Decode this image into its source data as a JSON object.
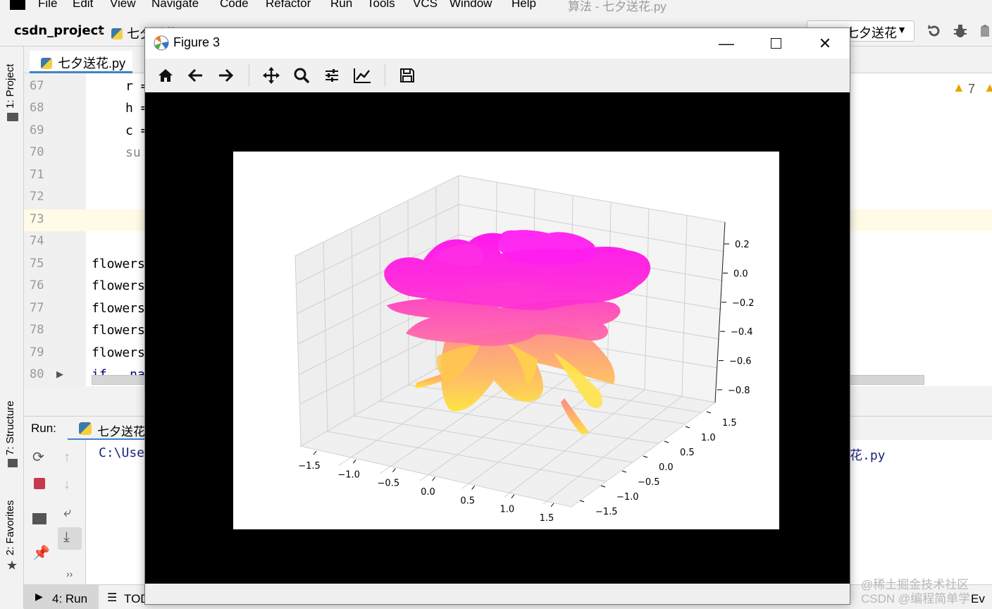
{
  "ide": {
    "menu": [
      "File",
      "Edit",
      "View",
      "Navigate",
      "Code",
      "Refactor",
      "Run",
      "Tools",
      "VCS",
      "Window",
      "Help"
    ],
    "window_title": "算法 - 七夕送花.py",
    "project": "csdn_project",
    "breadcrumb_file": "七夕送花",
    "run_config": "七夕送花",
    "editor_tab": "七夕送花.py",
    "warning_count": "7",
    "left_tabs": {
      "project": "1: Project",
      "structure": "7: Structure",
      "favorites": "2: Favorites"
    },
    "lines": [
      {
        "n": "67",
        "code": "r ="
      },
      {
        "n": "68",
        "code": "h ="
      },
      {
        "n": "69",
        "code": "c ="
      },
      {
        "n": "70",
        "code": "su"
      },
      {
        "n": "71",
        "code": ""
      },
      {
        "n": "72",
        "code": ""
      },
      {
        "n": "73",
        "code": ""
      },
      {
        "n": "74",
        "code": ""
      },
      {
        "n": "75",
        "code": "flowers"
      },
      {
        "n": "76",
        "code": "flowers"
      },
      {
        "n": "77",
        "code": "flowers"
      },
      {
        "n": "78",
        "code": "flowers"
      },
      {
        "n": "79",
        "code": "flowers"
      },
      {
        "n": "80",
        "code": "if __na"
      }
    ],
    "run_label": "Run:",
    "run_tab": "七夕送花",
    "console_left": "C:\\Use",
    "console_right": "花.py",
    "bottom_tabs": [
      "4: Run",
      "TODO"
    ],
    "bottom_right": "Ev"
  },
  "figure": {
    "title": "Figure 3",
    "toolbar": [
      "home-icon",
      "back-icon",
      "forward-icon",
      "pan-icon",
      "zoom-icon",
      "configure-icon",
      "edit-axes-icon",
      "save-icon"
    ]
  },
  "chart_data": {
    "type": "surface3d",
    "title": "",
    "x_ticks": [
      "−1.5",
      "−1.0",
      "−0.5",
      "0.0",
      "0.5",
      "1.0",
      "1.5"
    ],
    "y_ticks": [
      "−1.5",
      "−1.0",
      "−0.5",
      "0.0",
      "0.5",
      "1.0",
      "1.5"
    ],
    "z_ticks": [
      "0.2",
      "0.0",
      "−0.2",
      "−0.4",
      "−0.6",
      "−0.8"
    ],
    "xlim": [
      -1.5,
      1.5
    ],
    "ylim": [
      -1.5,
      1.5
    ],
    "zlim": [
      -0.8,
      0.2
    ],
    "colormap": "spring",
    "colors": {
      "top": "#ff14ef",
      "mid": "#ff6fb0",
      "bottom": "#ffec3a"
    }
  },
  "watermark": [
    "@稀土掘金技术社区",
    "CSDN @编程简单学"
  ]
}
